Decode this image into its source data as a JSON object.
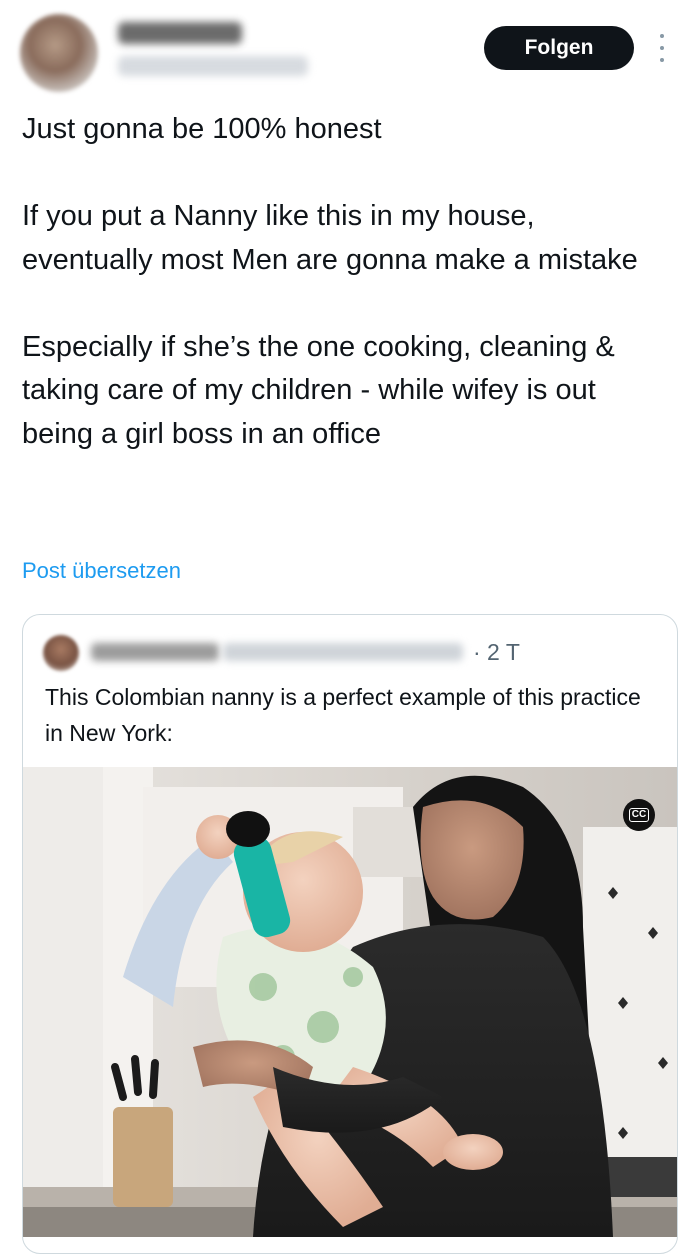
{
  "header": {
    "follow_label": "Folgen"
  },
  "tweet": {
    "text": "Just gonna be 100% honest\n\nIf you put a Nanny like this in my house, eventually most Men are gonna make a mistake\n\nEspecially if she’s the one cooking, cleaning & taking care of my children - while wifey is out being a girl boss in an office",
    "translate_label": "Post übersetzen"
  },
  "quote": {
    "time": "· 2 T",
    "text": "This Colombian nanny is a perfect example of this practice in New York:",
    "cc_label": "CC"
  },
  "colors": {
    "follow_bg": "#0f1419",
    "link": "#1d9bf0",
    "border": "#cfd9de",
    "muted": "#536471"
  }
}
